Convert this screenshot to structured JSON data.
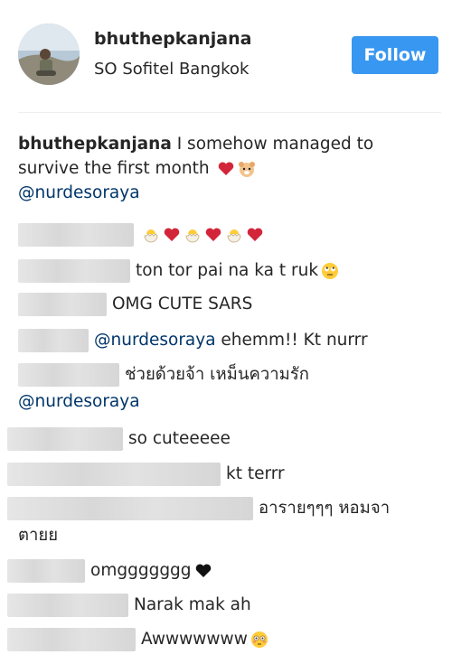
{
  "post": {
    "username": "bhuthepkanjana",
    "location": "SO Sofitel Bangkok",
    "follow_label": "Follow"
  },
  "caption": {
    "username": "bhuthepkanjana",
    "text_part1": "I somehow managed to",
    "text_part2": "survive the first month",
    "mention": "@nurdesoraya"
  },
  "comments": [
    {
      "text": "",
      "emojis": [
        "hatching-chick-icon",
        "heart-icon",
        "hatching-chick-icon",
        "heart-icon",
        "hatching-chick-icon",
        "heart-icon"
      ]
    },
    {
      "text": "ton tor pai na ka t ruk",
      "emojis": [
        "rolling-eyes-icon"
      ]
    },
    {
      "text": "OMG CUTE SARS"
    },
    {
      "mention": "@nurdesoraya",
      "text": " ehemm!! Kt nurrr"
    },
    {
      "text": "ช่วยด้วยจ้า เหม็นความรัก",
      "mention_line2": "@nurdesoraya"
    },
    {
      "text": "so cuteeeee"
    },
    {
      "text": "kt terrr"
    },
    {
      "text": "อารายๆๆๆ หอมจา",
      "text_line2": "ตายย"
    },
    {
      "text": "omggggggg",
      "emojis": [
        "black-heart-icon"
      ]
    },
    {
      "text": "Narak mak ah"
    },
    {
      "text": "Awwwwwww",
      "emojis": [
        "flushed-face-icon"
      ]
    }
  ]
}
